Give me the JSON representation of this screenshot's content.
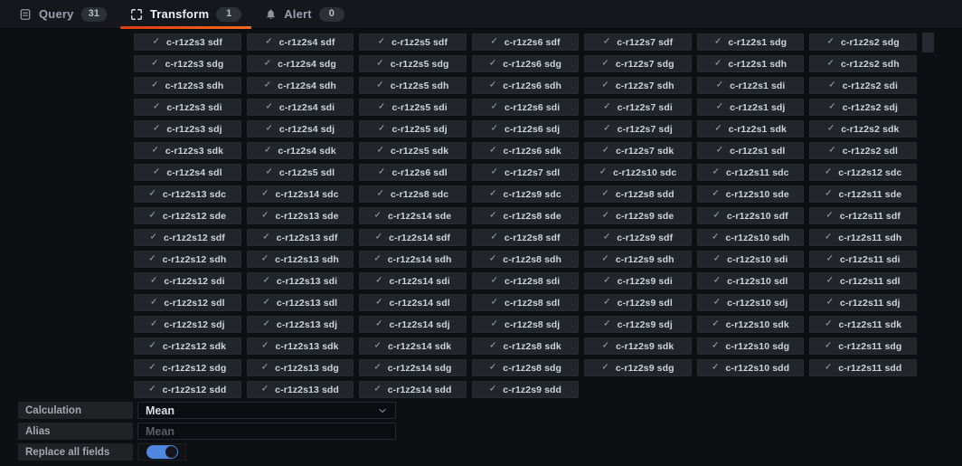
{
  "tabs": [
    {
      "label": "Query",
      "count": "31",
      "icon": "database-icon",
      "active": false
    },
    {
      "label": "Transform",
      "count": "1",
      "icon": "process-icon",
      "active": true
    },
    {
      "label": "Alert",
      "count": "0",
      "icon": "bell-icon",
      "active": false
    }
  ],
  "colors": {
    "active_tab_underline": "#e8501a",
    "toggle_on_blue": "#4e86e0",
    "pill_background": "#22252c",
    "page_background": "#0d0f13"
  },
  "selection_grid": {
    "check_glyph": "✓",
    "rows": [
      [
        "c-r1z2s3 sdf",
        "c-r1z2s4 sdf",
        "c-r1z2s5 sdf",
        "c-r1z2s6 sdf",
        "c-r1z2s7 sdf",
        "c-r1z2s1 sdg",
        "c-r1z2s2 sdg"
      ],
      [
        "c-r1z2s3 sdg",
        "c-r1z2s4 sdg",
        "c-r1z2s5 sdg",
        "c-r1z2s6 sdg",
        "c-r1z2s7 sdg",
        "c-r1z2s1 sdh",
        "c-r1z2s2 sdh"
      ],
      [
        "c-r1z2s3 sdh",
        "c-r1z2s4 sdh",
        "c-r1z2s5 sdh",
        "c-r1z2s6 sdh",
        "c-r1z2s7 sdh",
        "c-r1z2s1 sdi",
        "c-r1z2s2 sdi"
      ],
      [
        "c-r1z2s3 sdi",
        "c-r1z2s4 sdi",
        "c-r1z2s5 sdi",
        "c-r1z2s6 sdi",
        "c-r1z2s7 sdi",
        "c-r1z2s1 sdj",
        "c-r1z2s2 sdj"
      ],
      [
        "c-r1z2s3 sdj",
        "c-r1z2s4 sdj",
        "c-r1z2s5 sdj",
        "c-r1z2s6 sdj",
        "c-r1z2s7 sdj",
        "c-r1z2s1 sdk",
        "c-r1z2s2 sdk"
      ],
      [
        "c-r1z2s3 sdk",
        "c-r1z2s4 sdk",
        "c-r1z2s5 sdk",
        "c-r1z2s6 sdk",
        "c-r1z2s7 sdk",
        "c-r1z2s1 sdl",
        "c-r1z2s2 sdl"
      ],
      [
        "c-r1z2s4 sdl",
        "c-r1z2s5 sdl",
        "c-r1z2s6 sdl",
        "c-r1z2s7 sdl",
        "c-r1z2s10 sdc",
        "c-r1z2s11 sdc",
        "c-r1z2s12 sdc"
      ],
      [
        "c-r1z2s13 sdc",
        "c-r1z2s14 sdc",
        "c-r1z2s8 sdc",
        "c-r1z2s9 sdc",
        "c-r1z2s8 sdd",
        "c-r1z2s10 sde",
        "c-r1z2s11 sde"
      ],
      [
        "c-r1z2s12 sde",
        "c-r1z2s13 sde",
        "c-r1z2s14 sde",
        "c-r1z2s8 sde",
        "c-r1z2s9 sde",
        "c-r1z2s10 sdf",
        "c-r1z2s11 sdf"
      ],
      [
        "c-r1z2s12 sdf",
        "c-r1z2s13 sdf",
        "c-r1z2s14 sdf",
        "c-r1z2s8 sdf",
        "c-r1z2s9 sdf",
        "c-r1z2s10 sdh",
        "c-r1z2s11 sdh"
      ],
      [
        "c-r1z2s12 sdh",
        "c-r1z2s13 sdh",
        "c-r1z2s14 sdh",
        "c-r1z2s8 sdh",
        "c-r1z2s9 sdh",
        "c-r1z2s10 sdi",
        "c-r1z2s11 sdi"
      ],
      [
        "c-r1z2s12 sdi",
        "c-r1z2s13 sdi",
        "c-r1z2s14 sdi",
        "c-r1z2s8 sdi",
        "c-r1z2s9 sdi",
        "c-r1z2s10 sdl",
        "c-r1z2s11 sdl"
      ],
      [
        "c-r1z2s12 sdl",
        "c-r1z2s13 sdl",
        "c-r1z2s14 sdl",
        "c-r1z2s8 sdl",
        "c-r1z2s9 sdl",
        "c-r1z2s10 sdj",
        "c-r1z2s11 sdj"
      ],
      [
        "c-r1z2s12 sdj",
        "c-r1z2s13 sdj",
        "c-r1z2s14 sdj",
        "c-r1z2s8 sdj",
        "c-r1z2s9 sdj",
        "c-r1z2s10 sdk",
        "c-r1z2s11 sdk"
      ],
      [
        "c-r1z2s12 sdk",
        "c-r1z2s13 sdk",
        "c-r1z2s14 sdk",
        "c-r1z2s8 sdk",
        "c-r1z2s9 sdk",
        "c-r1z2s10 sdg",
        "c-r1z2s11 sdg"
      ],
      [
        "c-r1z2s12 sdg",
        "c-r1z2s13 sdg",
        "c-r1z2s14 sdg",
        "c-r1z2s8 sdg",
        "c-r1z2s9 sdg",
        "c-r1z2s10 sdd",
        "c-r1z2s11 sdd"
      ],
      [
        "c-r1z2s12 sdd",
        "c-r1z2s13 sdd",
        "c-r1z2s14 sdd",
        "c-r1z2s9 sdd"
      ]
    ]
  },
  "form": {
    "calculation": {
      "label": "Calculation",
      "value": "Mean"
    },
    "alias": {
      "label": "Alias",
      "placeholder": "Mean"
    },
    "replace_all_fields": {
      "label": "Replace all fields",
      "enabled": true
    }
  }
}
